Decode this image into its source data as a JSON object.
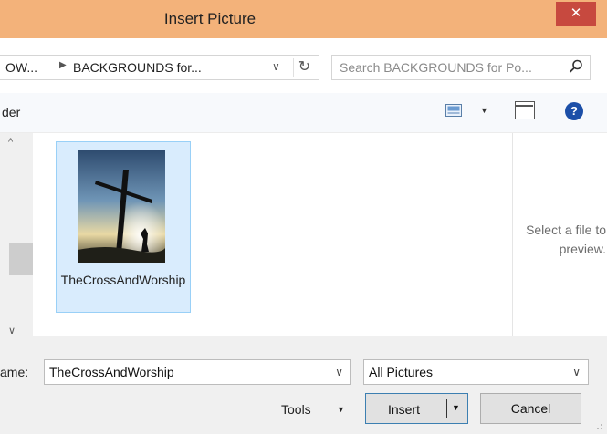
{
  "window": {
    "title": "Insert Picture",
    "close_glyph": "✕"
  },
  "address": {
    "crumbs": [
      "OW...",
      "BACKGROUNDS for..."
    ],
    "separator": "▶",
    "dropdown_glyph": "∨",
    "refresh_glyph": "↻"
  },
  "search": {
    "placeholder": "Search BACKGROUNDS for Po..."
  },
  "toolbar": {
    "partial_label": "der",
    "view_menu_glyph": "▼",
    "help_glyph": "?"
  },
  "file_list": {
    "items": [
      {
        "name": "TheCrossAndWorship",
        "selected": true
      }
    ]
  },
  "scrollbar": {
    "up_glyph": "^",
    "down_glyph": "∨"
  },
  "preview": {
    "message": "Select a file to preview."
  },
  "footer": {
    "filename_label": "ame:",
    "filename_value": "TheCrossAndWorship",
    "filetype_value": "All Pictures",
    "tools_label": "Tools",
    "insert_label": "Insert",
    "cancel_label": "Cancel",
    "dropdown_glyph": "∨",
    "menu_glyph": "▼"
  },
  "colors": {
    "titlebar": "#f3b27a",
    "close": "#c7493f",
    "selection": "#d9ecfd",
    "selection_border": "#99d0f7",
    "accent_border": "#3c7fb1"
  }
}
